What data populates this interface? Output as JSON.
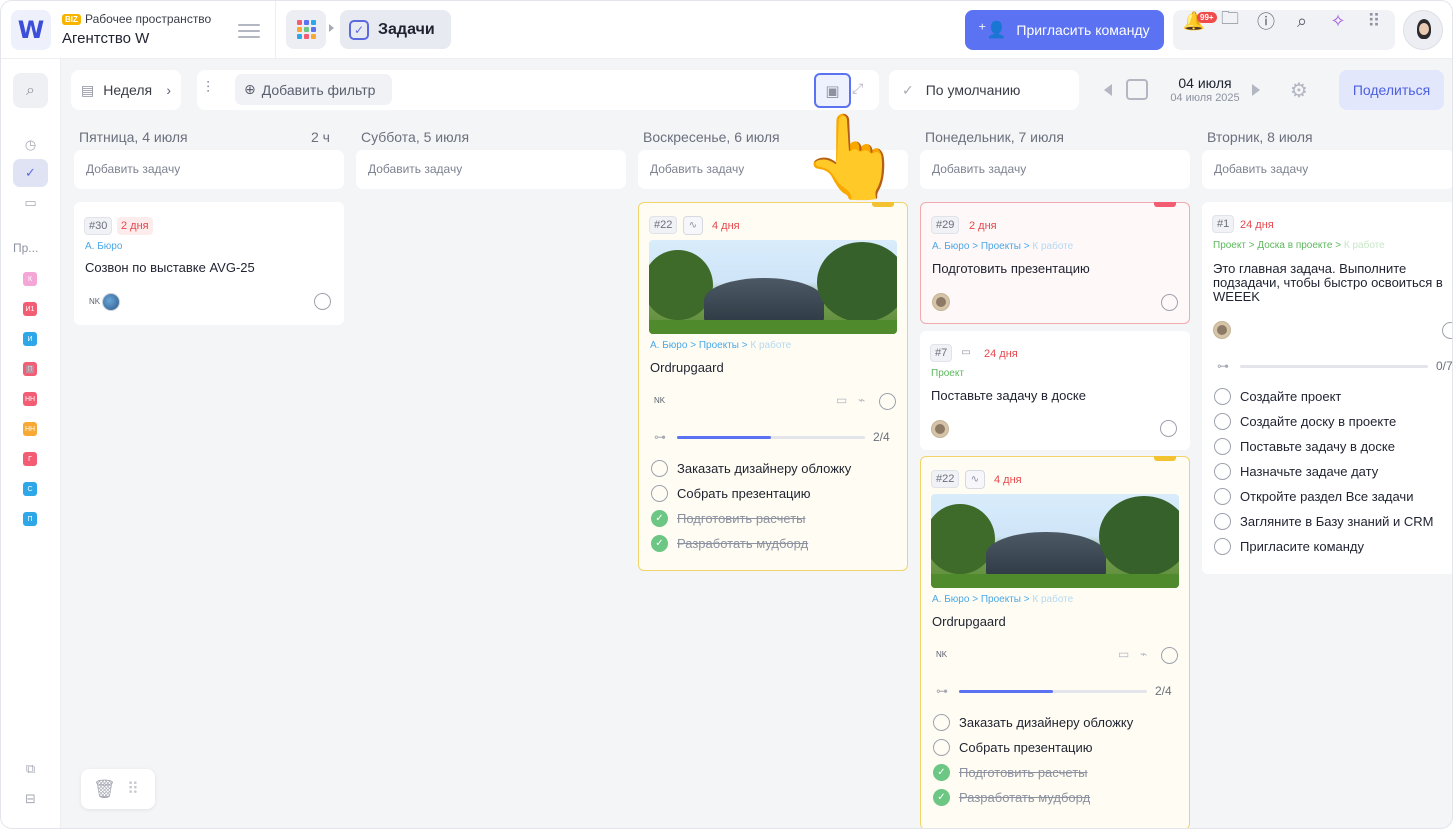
{
  "header": {
    "workspace_badge": "BIZ",
    "workspace_label": "Рабочее пространство",
    "workspace_name": "Агентство W",
    "logo_letter": "W",
    "tab_label": "Задачи",
    "invite_label": "Пригласить команду",
    "notif_count": "99+"
  },
  "sidebar": {
    "projects_label": "Пр...",
    "projects": [
      {
        "letter": "К",
        "color": "#f4a6d7"
      },
      {
        "letter": "И1",
        "color": "#f25d74"
      },
      {
        "letter": "И",
        "color": "#2ea7e8"
      },
      {
        "letter": "П",
        "color": "#f25d74"
      },
      {
        "letter": "НН",
        "color": "#f25d74"
      },
      {
        "letter": "НН",
        "color": "#f7a933"
      },
      {
        "letter": "Г",
        "color": "#f25d74"
      },
      {
        "letter": "С",
        "color": "#2ea7e8"
      },
      {
        "letter": "П",
        "color": "#2ea7e8"
      }
    ]
  },
  "toolbar": {
    "view_label": "Неделя",
    "add_filter_label": "Добавить фильтр",
    "sort_label": "По умолчанию",
    "date_main": "04 июля",
    "date_sub": "04 июля 2025",
    "share_label": "Поделиться"
  },
  "board": {
    "add_task_label": "Добавить задачу",
    "columns": [
      {
        "title": "Пятница, 4 июля",
        "hours": "2 ч"
      },
      {
        "title": "Суббота, 5 июля",
        "hours": ""
      },
      {
        "title": "Воскресенье, 6 июля",
        "hours": ""
      },
      {
        "title": "Понедельник, 7 июля",
        "hours": ""
      },
      {
        "title": "Вторник, 8 июля",
        "hours": ""
      }
    ]
  },
  "cards": {
    "c30": {
      "num": "#30",
      "due": "2 дня",
      "crumb": "А. Бюро",
      "title": "Созвон по выставке AVG-25",
      "initials": "NK"
    },
    "c22a": {
      "num": "#22",
      "due": "4 дня",
      "crumb1": "А. Бюро",
      "crumb2": "Проекты",
      "crumb3": "К работе",
      "title": "Ordrupgaard",
      "initials": "NK",
      "progress": "2/4",
      "subtasks": [
        "Заказать дизайнеру обложку",
        "Собрать презентацию",
        "Подготовить расчеты",
        "Разработать мудборд"
      ]
    },
    "c29": {
      "num": "#29",
      "due": "2 дня",
      "crumb1": "А. Бюро",
      "crumb2": "Проекты",
      "crumb3": "К работе",
      "title": "Подготовить презентацию"
    },
    "c7": {
      "num": "#7",
      "due": "24 дня",
      "crumb": "Проект",
      "title": "Поставьте задачу в доске"
    },
    "c22b": {
      "num": "#22",
      "due": "4 дня",
      "crumb1": "А. Бюро",
      "crumb2": "Проекты",
      "crumb3": "К работе",
      "title": "Ordrupgaard",
      "initials": "NK",
      "progress": "2/4",
      "subtasks": [
        "Заказать дизайнеру обложку",
        "Собрать презентацию",
        "Подготовить расчеты",
        "Разработать мудборд"
      ]
    },
    "c1": {
      "num": "#1",
      "due": "24 дня",
      "crumb1": "Проект",
      "crumb2": "Доска в проекте",
      "crumb3": "К работе",
      "title_l1": "Это главная задача. Выполните",
      "title_l2": "подзадачи, чтобы быстро освоиться в",
      "title_l3": "WEEEK",
      "progress": "0/7",
      "subtasks": [
        "Создайте проект",
        "Создайте доску в проекте",
        "Поставьте задачу в доске",
        "Назначьте задаче дату",
        "Откройте раздел Все задачи",
        "Загляните в Базу знаний и CRM",
        "Пригласите команду"
      ]
    }
  }
}
